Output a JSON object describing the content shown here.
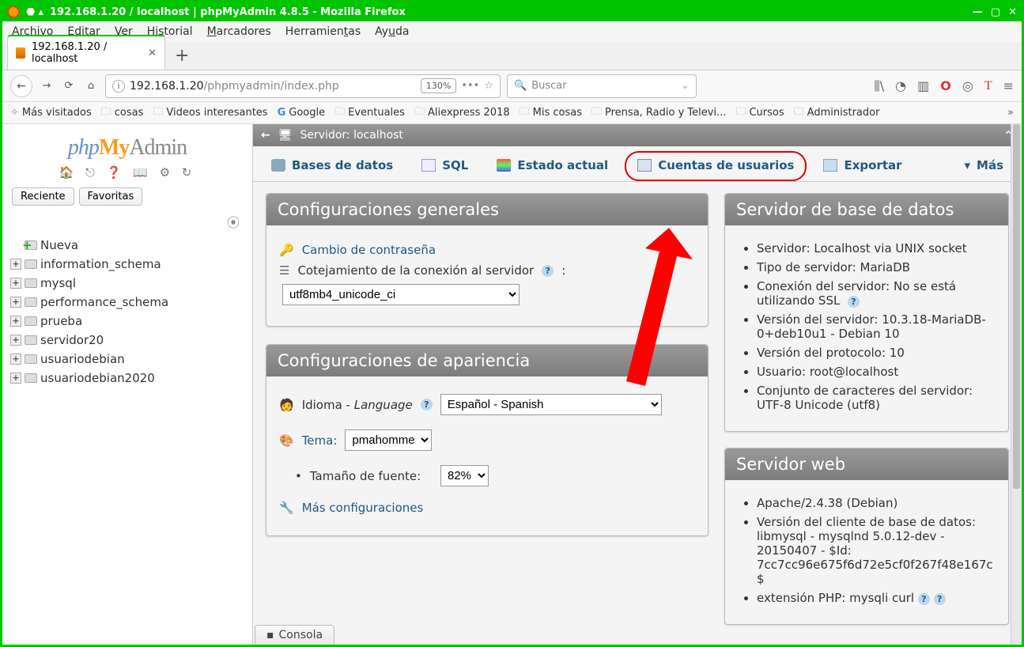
{
  "window": {
    "title": "192.168.1.20 / localhost | phpMyAdmin 4.8.5 - Mozilla Firefox"
  },
  "ff_menu": [
    "Archivo",
    "Editar",
    "Ver",
    "Historial",
    "Marcadores",
    "Herramientas",
    "Ayuda"
  ],
  "ff_menu_u": [
    "A",
    "E",
    "V",
    "H",
    "M",
    "t",
    "u"
  ],
  "tab": {
    "label": "192.168.1.20 / localhost"
  },
  "nav": {
    "url_host": "192.168.1.20",
    "url_path": "/phpmyadmin/index.php",
    "zoom": "130%",
    "search_placeholder": "Buscar"
  },
  "bookmarks": [
    "Más visitados",
    "cosas",
    "Videos interesantes",
    "Google",
    "Eventuales",
    "Aliexpress 2018",
    "Mis cosas",
    "Prensa, Radio y Televi...",
    "Cursos",
    "Administrador"
  ],
  "pma": {
    "logo": {
      "php": "php",
      "my": "My",
      "adm": "Admin"
    },
    "side_tabs": [
      "Reciente",
      "Favoritas"
    ],
    "tree_new": "Nueva",
    "tree": [
      "information_schema",
      "mysql",
      "performance_schema",
      "prueba",
      "servidor20",
      "usuariodebian",
      "usuariodebian2020"
    ]
  },
  "server_bar": {
    "label": "Servidor: localhost"
  },
  "tabs": {
    "db": "Bases de datos",
    "sql": "SQL",
    "status": "Estado actual",
    "users": "Cuentas de usuarios",
    "export": "Exportar",
    "more": "Más"
  },
  "general": {
    "title": "Configuraciones generales",
    "change_pw": "Cambio de contraseña",
    "collation_label": "Cotejamiento de la conexión al servidor",
    "collation_value": "utf8mb4_unicode_ci"
  },
  "appearance": {
    "title": "Configuraciones de apariencia",
    "lang_label": "Idioma",
    "lang_label2": "Language",
    "lang_value": "Español - Spanish",
    "theme_label": "Tema:",
    "theme_value": "pmahomme",
    "fontsize_label": "Tamaño de fuente:",
    "fontsize_value": "82%",
    "more": "Más configuraciones"
  },
  "dbserver": {
    "title": "Servidor de base de datos",
    "items": [
      "Servidor: Localhost via UNIX socket",
      "Tipo de servidor: MariaDB",
      "Conexión del servidor: No se está utilizando SSL",
      "Versión del servidor: 10.3.18-MariaDB-0+deb10u1 - Debian 10",
      "Versión del protocolo: 10",
      "Usuario: root@localhost",
      "Conjunto de caracteres del servidor: UTF-8 Unicode (utf8)"
    ]
  },
  "webserver": {
    "title": "Servidor web",
    "items": [
      "Apache/2.4.38 (Debian)",
      "Versión del cliente de base de datos: libmysql - mysqlnd 5.0.12-dev - 20150407 - $Id: 7cc7cc96e675f6d72e5cf0f267f48e167c $",
      "extensión PHP: mysqli  curl"
    ]
  },
  "console": "Consola"
}
